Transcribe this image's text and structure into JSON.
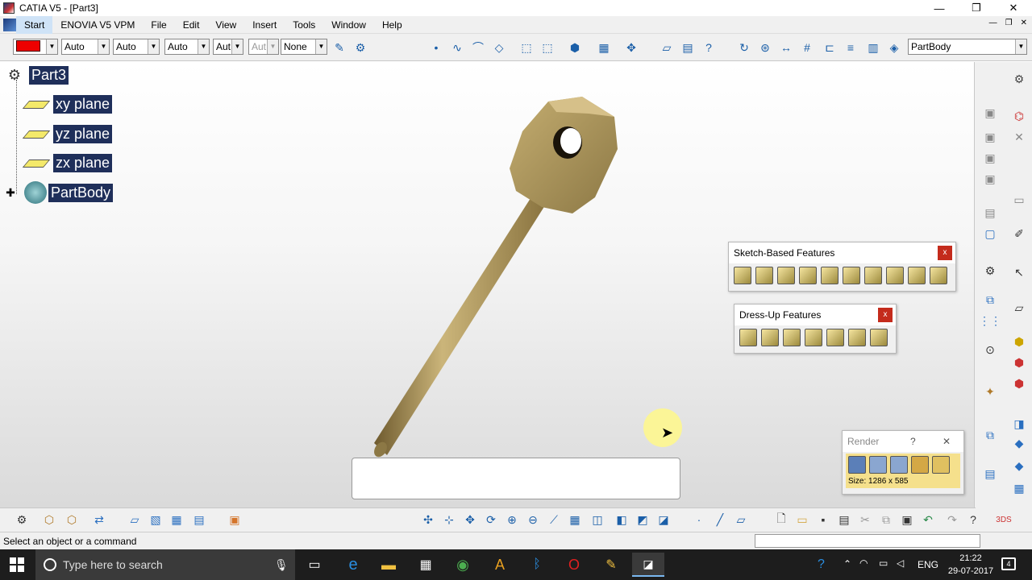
{
  "window": {
    "title": "CATIA V5 - [Part3]",
    "minimize": "—",
    "restore": "❐",
    "close": "✕"
  },
  "menubar": {
    "items": [
      "Start",
      "ENOVIA V5 VPM",
      "File",
      "Edit",
      "View",
      "Insert",
      "Tools",
      "Window",
      "Help"
    ],
    "mdi": [
      "—",
      "❐",
      "✕"
    ]
  },
  "toolbar_top": {
    "color_value": "red",
    "combos": [
      "Auto",
      "Auto",
      "Auto",
      "Aut",
      "Aut",
      "None"
    ],
    "current_body": "PartBody"
  },
  "tree": {
    "root": "Part3",
    "children": [
      "xy plane",
      "yz plane",
      "zx plane",
      "PartBody"
    ]
  },
  "panels": {
    "sketch": {
      "title": "Sketch-Based Features",
      "close": "x"
    },
    "dressup": {
      "title": "Dress-Up Features",
      "close": "x"
    },
    "render": {
      "title": "Render",
      "help": "?",
      "close": "✕",
      "size": "Size: 1286 x 585"
    }
  },
  "status": {
    "message": "Select an object or a command"
  },
  "taskbar": {
    "search_placeholder": "Type here to search",
    "language": "ENG",
    "time": "21:22",
    "date": "29-07-2017",
    "notifications": "4"
  },
  "colors": {
    "tree_label_bg": "#1f2f5a",
    "part_color": "#b59a5c",
    "taskbar_bg": "#1d1d1d"
  }
}
